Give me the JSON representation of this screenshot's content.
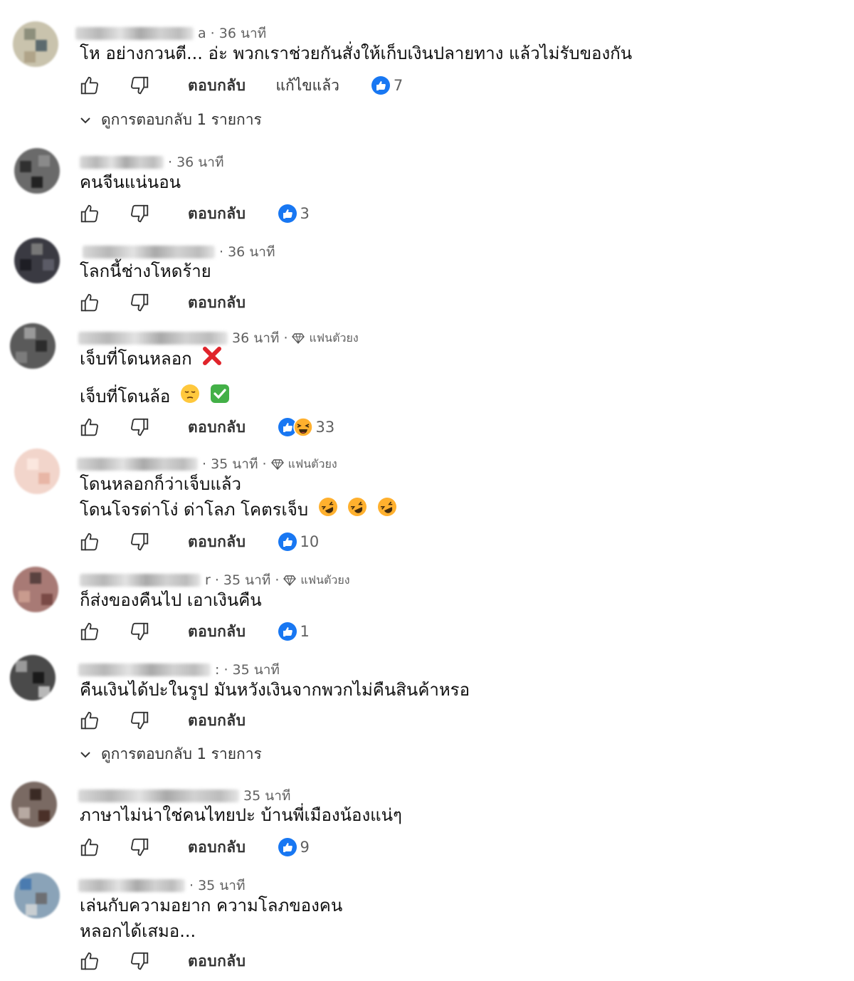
{
  "labels": {
    "reply": "ตอบกลับ",
    "edited": "แก้ไขแล้ว",
    "view_replies": "ดูการตอบกลับ 1 รายการ",
    "fan_badge": "แฟนตัวยง"
  },
  "comments": [
    {
      "time": "a · 36 นาที",
      "lines": [
        "โห อย่างกวนตี... อ่ะ พวกเราช่วยกันสั่งให้เก็บเงินปลายทาง แล้วไม่รับของกัน"
      ],
      "reaction_count": "7",
      "edited": true,
      "replies": true
    },
    {
      "time": "· 36 นาที",
      "lines": [
        "คนจีนแน่นอน"
      ],
      "reaction_count": "3"
    },
    {
      "time": "· 36 นาที",
      "lines": [
        "โลกนี้ช่างโหดร้าย"
      ],
      "reaction_count": ""
    },
    {
      "time": "36 นาที ·",
      "fan": true,
      "lines": [
        "เจ็บที่โดนหลอก",
        "เจ็บที่โดนล้อ"
      ],
      "reaction_count": "33"
    },
    {
      "time": "· 35 นาที ·",
      "fan": true,
      "lines": [
        "โดนหลอกก็ว่าเจ็บแล้ว",
        "โดนโจรด่าโง่ ด่าโลภ โคตรเจ็บ"
      ],
      "reaction_count": "10"
    },
    {
      "time": "r · 35 นาที ·",
      "fan": true,
      "lines": [
        "ก็ส่งของคืนไป เอาเงินคืน"
      ],
      "reaction_count": "1"
    },
    {
      "time": ": · 35 นาที",
      "lines": [
        "คืนเงินได้ปะในรูป มันหวังเงินจากพวกไม่คืนสินค้าหรอ"
      ],
      "reaction_count": "",
      "replies": true
    },
    {
      "time": "35 นาที",
      "lines": [
        "ภาษาไม่น่าใช่คนไทยปะ บ้านพี่เมืองน้องแน่ๆ"
      ],
      "reaction_count": "9"
    },
    {
      "time": "· 35 นาที",
      "lines": [
        "เล่นกับความอยาก ความโลภของคน",
        "หลอกได้เสมอ..."
      ],
      "reaction_count": ""
    }
  ]
}
